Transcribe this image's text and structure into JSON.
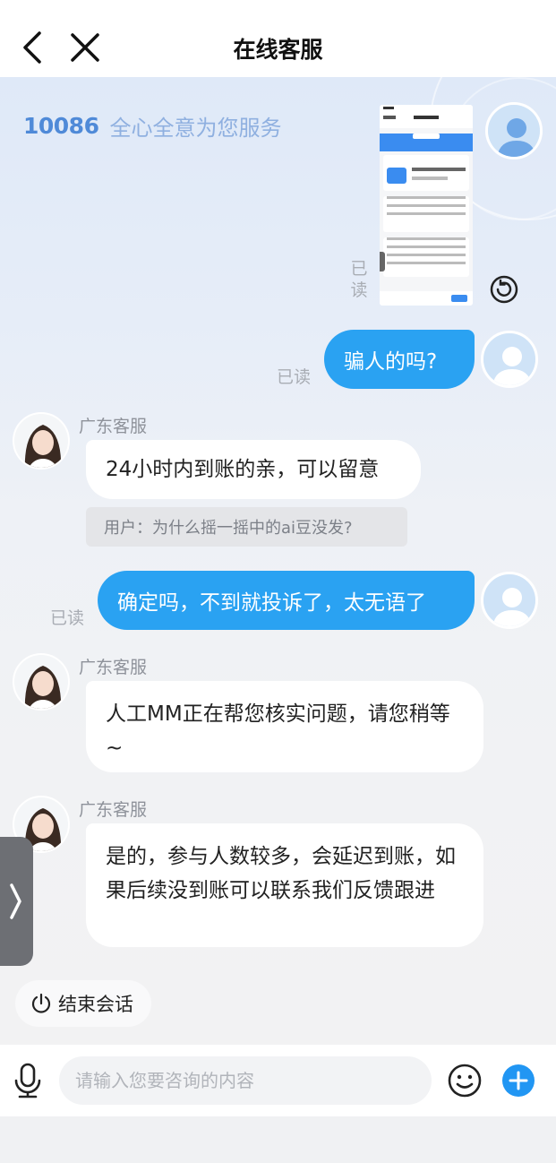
{
  "nav": {
    "title": "在线客服"
  },
  "banner": {
    "logo": "10086",
    "slogan": "全心全意为您服务"
  },
  "messages": {
    "m1": {
      "read": "已\n读"
    },
    "m2": {
      "text": "骗人的吗?",
      "read": "已读"
    },
    "m3": {
      "agent": "广东客服",
      "text": "24小时内到账的亲，可以留意",
      "quote": "用户：为什么摇一摇中的ai豆没发?"
    },
    "m4": {
      "text": "确定吗，不到就投诉了，太无语了",
      "read": "已读"
    },
    "m5": {
      "agent": "广东客服",
      "text": "人工MM正在帮您核实问题，请您稍等~"
    },
    "m6": {
      "agent": "广东客服",
      "text": "是的，参与人数较多，会延迟到账，如果后续没到账可以联系我们反馈跟进"
    }
  },
  "actions": {
    "end_session": "结束会话"
  },
  "input": {
    "placeholder": "请输入您要咨询的内容"
  },
  "colors": {
    "user_bubble": "#2aa2f2",
    "plus_button": "#2196f3"
  }
}
